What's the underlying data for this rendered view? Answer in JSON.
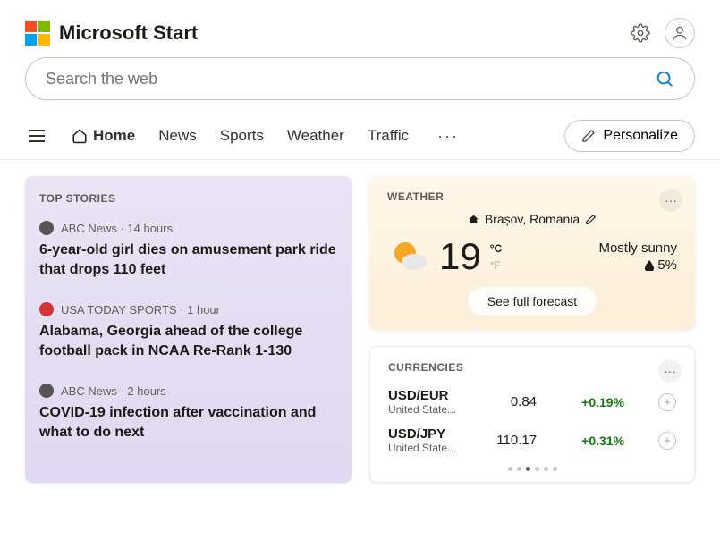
{
  "brand": "Microsoft Start",
  "search": {
    "placeholder": "Search the web"
  },
  "nav": {
    "items": [
      "Home",
      "News",
      "Sports",
      "Weather",
      "Traffic"
    ],
    "personalize": "Personalize"
  },
  "top_stories": {
    "title": "TOP STORIES",
    "stories": [
      {
        "source": "ABC News",
        "age": "14 hours",
        "title": "6-year-old girl dies on amusement park ride that drops 110 feet",
        "color": "dark"
      },
      {
        "source": "USA TODAY SPORTS",
        "age": "1 hour",
        "title": "Alabama, Georgia ahead of the college football pack in NCAA Re-Rank 1-130",
        "color": "red"
      },
      {
        "source": "ABC News",
        "age": "2 hours",
        "title": "COVID-19 infection after vaccination and what to do next",
        "color": "dark"
      }
    ]
  },
  "weather": {
    "title": "WEATHER",
    "location": "Brașov, Romania",
    "temp": "19",
    "unit_c": "°C",
    "unit_f": "°F",
    "condition": "Mostly sunny",
    "humidity": "5%",
    "forecast_btn": "See full forecast"
  },
  "currencies": {
    "title": "CURRENCIES",
    "rows": [
      {
        "pair": "USD/EUR",
        "desc": "United State...",
        "value": "0.84",
        "change": "+0.19%"
      },
      {
        "pair": "USD/JPY",
        "desc": "United State...",
        "value": "110.17",
        "change": "+0.31%"
      }
    ],
    "active_page": 2,
    "total_pages": 6
  }
}
